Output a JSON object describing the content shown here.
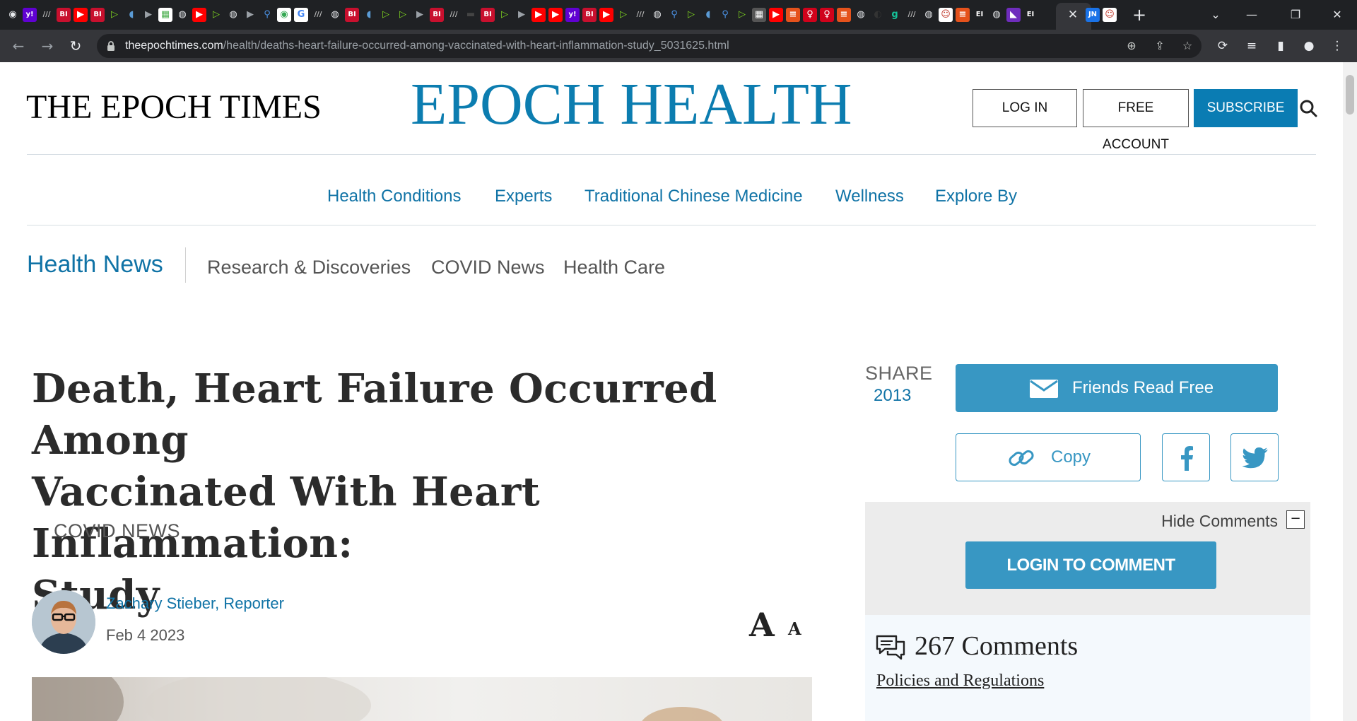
{
  "browser": {
    "tab_icons": [
      {
        "glyph": "◉",
        "color": "#e8eaed",
        "bg": "transparent"
      },
      {
        "glyph": "y!",
        "color": "#ffffff",
        "bg": "#6001d2"
      },
      {
        "glyph": "///",
        "color": "#bbbbbb",
        "bg": "transparent"
      },
      {
        "glyph": "BI",
        "color": "#ffffff",
        "bg": "#c8102e"
      },
      {
        "glyph": "▶",
        "color": "#ffffff",
        "bg": "#ff0000"
      },
      {
        "glyph": "BI",
        "color": "#ffffff",
        "bg": "#c8102e"
      },
      {
        "glyph": "▷",
        "color": "#7ed321",
        "bg": "transparent"
      },
      {
        "glyph": "◖",
        "color": "#5b9bd5",
        "bg": "transparent"
      },
      {
        "glyph": "▶",
        "color": "#9aa0a6",
        "bg": "transparent"
      },
      {
        "glyph": "▦",
        "color": "#4caf50",
        "bg": "#ffffff"
      },
      {
        "glyph": "◍",
        "color": "#e8eaed",
        "bg": "transparent"
      },
      {
        "glyph": "▶",
        "color": "#ffffff",
        "bg": "#ff0000"
      },
      {
        "glyph": "▷",
        "color": "#7ed321",
        "bg": "transparent"
      },
      {
        "glyph": "◍",
        "color": "#e8eaed",
        "bg": "transparent"
      },
      {
        "glyph": "▶",
        "color": "#9aa0a6",
        "bg": "transparent"
      },
      {
        "glyph": "⚲",
        "color": "#4a90e2",
        "bg": "transparent"
      },
      {
        "glyph": "◉",
        "color": "#34a853",
        "bg": "#ffffff"
      },
      {
        "glyph": "G",
        "color": "#4285f4",
        "bg": "#ffffff"
      },
      {
        "glyph": "///",
        "color": "#bbbbbb",
        "bg": "transparent"
      },
      {
        "glyph": "◍",
        "color": "#e8eaed",
        "bg": "transparent"
      },
      {
        "glyph": "BI",
        "color": "#ffffff",
        "bg": "#c8102e"
      },
      {
        "glyph": "◖",
        "color": "#5b9bd5",
        "bg": "transparent"
      },
      {
        "glyph": "▷",
        "color": "#7ed321",
        "bg": "transparent"
      },
      {
        "glyph": "▷",
        "color": "#7ed321",
        "bg": "transparent"
      },
      {
        "glyph": "▶",
        "color": "#9aa0a6",
        "bg": "transparent"
      },
      {
        "glyph": "BI",
        "color": "#ffffff",
        "bg": "#c8102e"
      },
      {
        "glyph": "///",
        "color": "#bbbbbb",
        "bg": "transparent"
      },
      {
        "glyph": "▬",
        "color": "#444444",
        "bg": "transparent"
      },
      {
        "glyph": "BI",
        "color": "#ffffff",
        "bg": "#c8102e"
      },
      {
        "glyph": "▷",
        "color": "#7ed321",
        "bg": "transparent"
      },
      {
        "glyph": "▶",
        "color": "#9aa0a6",
        "bg": "transparent"
      },
      {
        "glyph": "▶",
        "color": "#ffffff",
        "bg": "#ff0000"
      },
      {
        "glyph": "▶",
        "color": "#ffffff",
        "bg": "#ff0000"
      },
      {
        "glyph": "y!",
        "color": "#ffffff",
        "bg": "#6001d2"
      },
      {
        "glyph": "BI",
        "color": "#ffffff",
        "bg": "#c8102e"
      },
      {
        "glyph": "▶",
        "color": "#ffffff",
        "bg": "#ff0000"
      },
      {
        "glyph": "▷",
        "color": "#7ed321",
        "bg": "transparent"
      },
      {
        "glyph": "///",
        "color": "#bbbbbb",
        "bg": "transparent"
      },
      {
        "glyph": "◍",
        "color": "#e8eaed",
        "bg": "transparent"
      },
      {
        "glyph": "⚲",
        "color": "#4a90e2",
        "bg": "transparent"
      },
      {
        "glyph": "▷",
        "color": "#7ed321",
        "bg": "transparent"
      },
      {
        "glyph": "◖",
        "color": "#5b9bd5",
        "bg": "transparent"
      },
      {
        "glyph": "⚲",
        "color": "#4a90e2",
        "bg": "transparent"
      },
      {
        "glyph": "▷",
        "color": "#7ed321",
        "bg": "transparent"
      },
      {
        "glyph": "▦",
        "color": "#ffffff",
        "bg": "#555555"
      },
      {
        "glyph": "▶",
        "color": "#ffffff",
        "bg": "#ff0000"
      },
      {
        "glyph": "≡",
        "color": "#ffffff",
        "bg": "#e5521c"
      },
      {
        "glyph": "♀",
        "color": "#ffffff",
        "bg": "#d0021b"
      },
      {
        "glyph": "♀",
        "color": "#ffffff",
        "bg": "#d0021b"
      },
      {
        "glyph": "≡",
        "color": "#ffffff",
        "bg": "#e5521c"
      },
      {
        "glyph": "◍",
        "color": "#e8eaed",
        "bg": "transparent"
      },
      {
        "glyph": "◐",
        "color": "#333333",
        "bg": "transparent"
      },
      {
        "glyph": "g",
        "color": "#15c39a",
        "bg": "transparent"
      },
      {
        "glyph": "///",
        "color": "#bbbbbb",
        "bg": "transparent"
      },
      {
        "glyph": "◍",
        "color": "#e8eaed",
        "bg": "transparent"
      },
      {
        "glyph": "☺",
        "color": "#c0392b",
        "bg": "#ffffff"
      },
      {
        "glyph": "≡",
        "color": "#ffffff",
        "bg": "#e5521c"
      },
      {
        "glyph": "EI",
        "color": "#ffffff",
        "bg": "transparent"
      },
      {
        "glyph": "◍",
        "color": "#e8eaed",
        "bg": "transparent"
      },
      {
        "glyph": "◣",
        "color": "#ffffff",
        "bg": "#6f2dbd"
      },
      {
        "glyph": "EI",
        "color": "#ffffff",
        "bg": "transparent"
      }
    ],
    "tail_icons": [
      {
        "glyph": "JN",
        "color": "#ffffff",
        "bg": "#1a73e8"
      },
      {
        "glyph": "☺",
        "color": "#c0392b",
        "bg": "#ffffff"
      }
    ],
    "tab_close": "✕",
    "new_tab": "+",
    "tab_search": "⌄",
    "minimize": "—",
    "restore": "❐",
    "close_window": "✕",
    "back": "←",
    "forward": "→",
    "reload": "↻",
    "url_host": "theepochtimes.com",
    "url_path": "/health/deaths-heart-failure-occurred-among-vaccinated-with-heart-inflammation-study_5031625.html",
    "omni_icons": [
      "⊕",
      "⇪",
      "☆"
    ],
    "toolbar_icons": [
      "⟳",
      "≡",
      "▮",
      "●",
      "⋮"
    ]
  },
  "header": {
    "brand": "THE EPOCH TIMES",
    "section_brand": "EPOCH HEALTH",
    "login": "LOG IN",
    "free_account": "FREE ACCOUNT",
    "subscribe": "SUBSCRIBE"
  },
  "main_nav": [
    "Health Conditions",
    "Experts",
    "Traditional Chinese Medicine",
    "Wellness",
    "Explore By"
  ],
  "sub_nav": {
    "title": "Health News",
    "items": [
      "Research & Discoveries",
      "COVID News",
      "Health Care"
    ]
  },
  "article": {
    "headline_lines": [
      "Death, Heart Failure Occurred Among",
      "Vaccinated With Heart Inflammation:",
      "Study"
    ],
    "category": "COVID NEWS",
    "author": "Zachary Stieber, Reporter",
    "date": "Feb 4 2023",
    "font_large": "A",
    "font_small": "A"
  },
  "share": {
    "label": "SHARE",
    "count": "2013",
    "friends_read_free": "Friends Read Free",
    "copy": "Copy"
  },
  "comments": {
    "hide_label": "Hide Comments",
    "hide_toggle": "−",
    "login_button": "LOGIN TO COMMENT",
    "count_text": "267 Comments",
    "policies": "Policies and Regulations"
  },
  "colors": {
    "brand_blue": "#0c7db0",
    "nav_blue": "#1073a6",
    "share_blue": "#3897c3",
    "chrome_dark": "#1f2124",
    "chrome_toolbar": "#35363a"
  }
}
